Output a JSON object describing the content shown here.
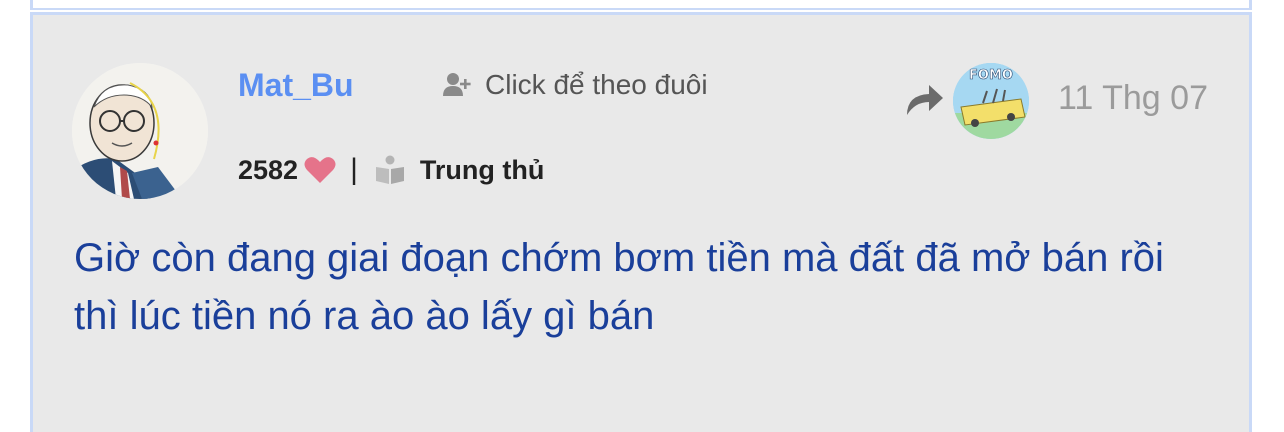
{
  "post": {
    "username": "Mat_Bu",
    "follow_label": "Click để theo đuôi",
    "reputation": "2582",
    "separator": "|",
    "rank": "Trung thủ",
    "date": "11 Thg 07",
    "forum_logo_text": "FOMO",
    "content": "Giờ còn đang giai đoạn chớm bơm tiền mà đất đã mở bán rồi thì lúc tiền nó ra ào ào lấy gì bán"
  },
  "colors": {
    "username": "#5b8ff2",
    "content_text": "#1a3f9a",
    "card_background": "#e9e9e9",
    "card_border": "#c9d9f7",
    "heart": "#e5738a",
    "muted_text": "#9b9b9b"
  },
  "icons": {
    "follow": "user-plus-icon",
    "reputation": "heart-icon",
    "rank": "book-icon",
    "share": "share-arrow-icon"
  }
}
